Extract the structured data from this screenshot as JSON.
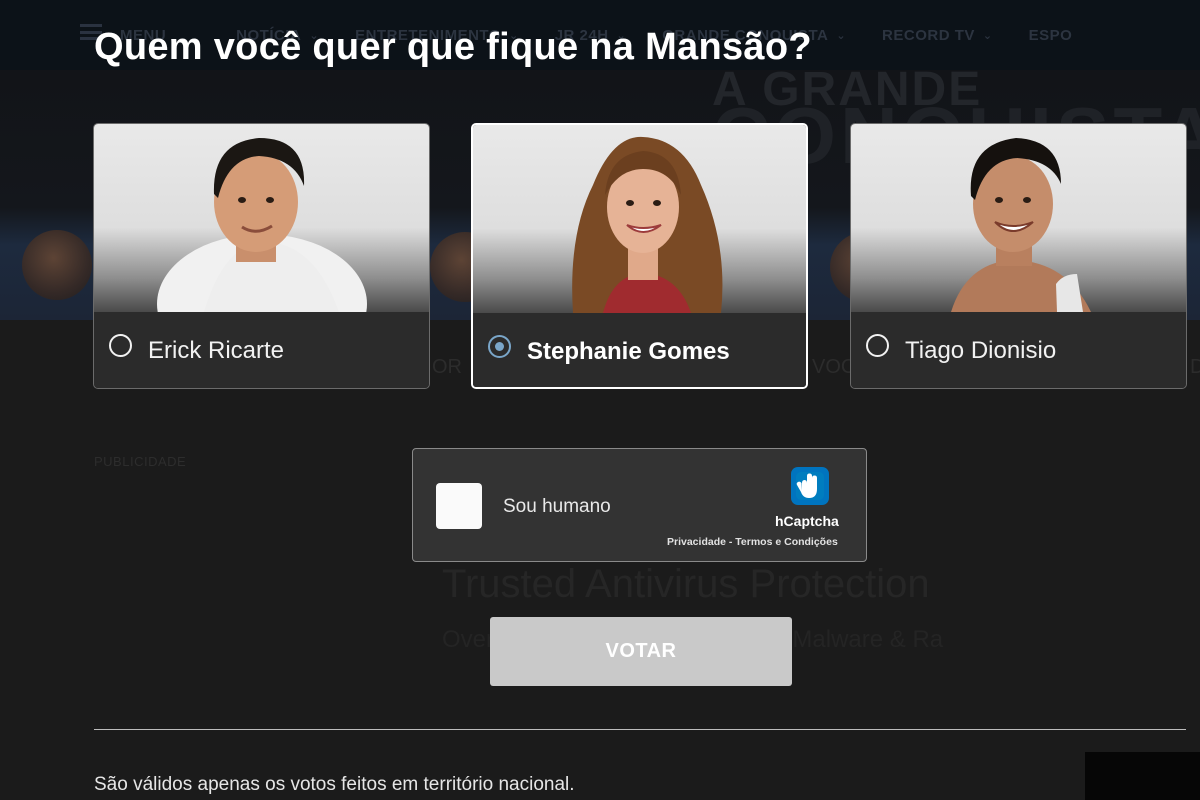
{
  "background_site": {
    "nav_items": [
      {
        "label": "MENU",
        "chevron": ""
      },
      {
        "label": "NOTÍCIA",
        "chevron": "⌄"
      },
      {
        "label": "ENTRETENIMENTO",
        "chevron": "⌄"
      },
      {
        "label": "JR 24H",
        "chevron": "⌄"
      },
      {
        "label": "GRANDE CONQUISTA",
        "chevron": "⌄"
      },
      {
        "label": "RECORD TV",
        "chevron": "⌄"
      },
      {
        "label": "ESPO",
        "chevron": ""
      }
    ],
    "banner_line1": "A GRANDE",
    "banner_line2": "CONQUISTA",
    "ad_label": "PUBLICIDADE",
    "ad_title": "Trusted Antivirus Protection",
    "ad_subtitle": "Over ... Tested & Proven to Stop Malware & Ra",
    "ghost_fragments": [
      "OR",
      "VOC",
      "D"
    ]
  },
  "poll": {
    "title": "Quem você quer que fique na Mansão?",
    "candidates": [
      {
        "name": "Erick Ricarte",
        "selected": false
      },
      {
        "name": "Stephanie Gomes",
        "selected": true
      },
      {
        "name": "Tiago Dionisio",
        "selected": false
      }
    ],
    "selection_color": "#7aa6c9"
  },
  "captcha": {
    "label": "Sou humano",
    "brand": "hCaptcha",
    "links": "Privacidade - Termos e Condições",
    "logo_color": "#0074bf"
  },
  "vote_button": {
    "label": "VOTAR",
    "color": "#c9c9c9"
  },
  "footer": {
    "disclaimer": "São válidos apenas os votos feitos em território nacional."
  }
}
